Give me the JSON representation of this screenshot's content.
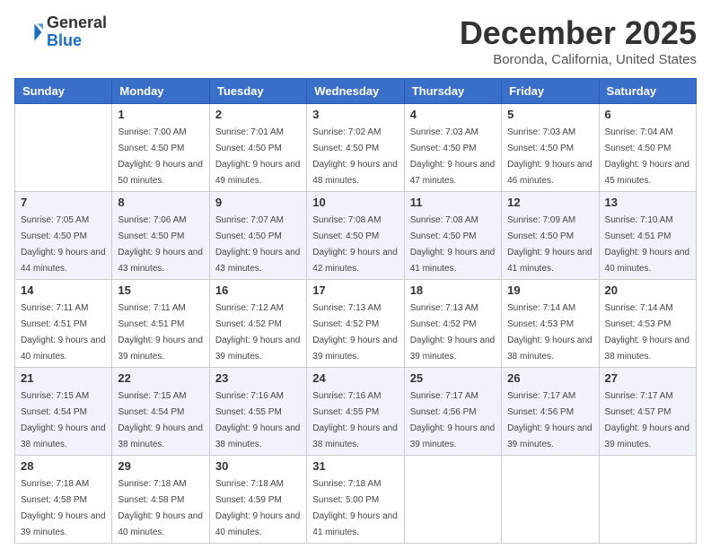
{
  "logo": {
    "general": "General",
    "blue": "Blue"
  },
  "header": {
    "month": "December 2025",
    "location": "Boronda, California, United States"
  },
  "weekdays": [
    "Sunday",
    "Monday",
    "Tuesday",
    "Wednesday",
    "Thursday",
    "Friday",
    "Saturday"
  ],
  "weeks": [
    [
      {
        "day": "",
        "sunrise": "",
        "sunset": "",
        "daylight": ""
      },
      {
        "day": "1",
        "sunrise": "Sunrise: 7:00 AM",
        "sunset": "Sunset: 4:50 PM",
        "daylight": "Daylight: 9 hours and 50 minutes."
      },
      {
        "day": "2",
        "sunrise": "Sunrise: 7:01 AM",
        "sunset": "Sunset: 4:50 PM",
        "daylight": "Daylight: 9 hours and 49 minutes."
      },
      {
        "day": "3",
        "sunrise": "Sunrise: 7:02 AM",
        "sunset": "Sunset: 4:50 PM",
        "daylight": "Daylight: 9 hours and 48 minutes."
      },
      {
        "day": "4",
        "sunrise": "Sunrise: 7:03 AM",
        "sunset": "Sunset: 4:50 PM",
        "daylight": "Daylight: 9 hours and 47 minutes."
      },
      {
        "day": "5",
        "sunrise": "Sunrise: 7:03 AM",
        "sunset": "Sunset: 4:50 PM",
        "daylight": "Daylight: 9 hours and 46 minutes."
      },
      {
        "day": "6",
        "sunrise": "Sunrise: 7:04 AM",
        "sunset": "Sunset: 4:50 PM",
        "daylight": "Daylight: 9 hours and 45 minutes."
      }
    ],
    [
      {
        "day": "7",
        "sunrise": "Sunrise: 7:05 AM",
        "sunset": "Sunset: 4:50 PM",
        "daylight": "Daylight: 9 hours and 44 minutes."
      },
      {
        "day": "8",
        "sunrise": "Sunrise: 7:06 AM",
        "sunset": "Sunset: 4:50 PM",
        "daylight": "Daylight: 9 hours and 43 minutes."
      },
      {
        "day": "9",
        "sunrise": "Sunrise: 7:07 AM",
        "sunset": "Sunset: 4:50 PM",
        "daylight": "Daylight: 9 hours and 43 minutes."
      },
      {
        "day": "10",
        "sunrise": "Sunrise: 7:08 AM",
        "sunset": "Sunset: 4:50 PM",
        "daylight": "Daylight: 9 hours and 42 minutes."
      },
      {
        "day": "11",
        "sunrise": "Sunrise: 7:08 AM",
        "sunset": "Sunset: 4:50 PM",
        "daylight": "Daylight: 9 hours and 41 minutes."
      },
      {
        "day": "12",
        "sunrise": "Sunrise: 7:09 AM",
        "sunset": "Sunset: 4:50 PM",
        "daylight": "Daylight: 9 hours and 41 minutes."
      },
      {
        "day": "13",
        "sunrise": "Sunrise: 7:10 AM",
        "sunset": "Sunset: 4:51 PM",
        "daylight": "Daylight: 9 hours and 40 minutes."
      }
    ],
    [
      {
        "day": "14",
        "sunrise": "Sunrise: 7:11 AM",
        "sunset": "Sunset: 4:51 PM",
        "daylight": "Daylight: 9 hours and 40 minutes."
      },
      {
        "day": "15",
        "sunrise": "Sunrise: 7:11 AM",
        "sunset": "Sunset: 4:51 PM",
        "daylight": "Daylight: 9 hours and 39 minutes."
      },
      {
        "day": "16",
        "sunrise": "Sunrise: 7:12 AM",
        "sunset": "Sunset: 4:52 PM",
        "daylight": "Daylight: 9 hours and 39 minutes."
      },
      {
        "day": "17",
        "sunrise": "Sunrise: 7:13 AM",
        "sunset": "Sunset: 4:52 PM",
        "daylight": "Daylight: 9 hours and 39 minutes."
      },
      {
        "day": "18",
        "sunrise": "Sunrise: 7:13 AM",
        "sunset": "Sunset: 4:52 PM",
        "daylight": "Daylight: 9 hours and 39 minutes."
      },
      {
        "day": "19",
        "sunrise": "Sunrise: 7:14 AM",
        "sunset": "Sunset: 4:53 PM",
        "daylight": "Daylight: 9 hours and 38 minutes."
      },
      {
        "day": "20",
        "sunrise": "Sunrise: 7:14 AM",
        "sunset": "Sunset: 4:53 PM",
        "daylight": "Daylight: 9 hours and 38 minutes."
      }
    ],
    [
      {
        "day": "21",
        "sunrise": "Sunrise: 7:15 AM",
        "sunset": "Sunset: 4:54 PM",
        "daylight": "Daylight: 9 hours and 38 minutes."
      },
      {
        "day": "22",
        "sunrise": "Sunrise: 7:15 AM",
        "sunset": "Sunset: 4:54 PM",
        "daylight": "Daylight: 9 hours and 38 minutes."
      },
      {
        "day": "23",
        "sunrise": "Sunrise: 7:16 AM",
        "sunset": "Sunset: 4:55 PM",
        "daylight": "Daylight: 9 hours and 38 minutes."
      },
      {
        "day": "24",
        "sunrise": "Sunrise: 7:16 AM",
        "sunset": "Sunset: 4:55 PM",
        "daylight": "Daylight: 9 hours and 38 minutes."
      },
      {
        "day": "25",
        "sunrise": "Sunrise: 7:17 AM",
        "sunset": "Sunset: 4:56 PM",
        "daylight": "Daylight: 9 hours and 39 minutes."
      },
      {
        "day": "26",
        "sunrise": "Sunrise: 7:17 AM",
        "sunset": "Sunset: 4:56 PM",
        "daylight": "Daylight: 9 hours and 39 minutes."
      },
      {
        "day": "27",
        "sunrise": "Sunrise: 7:17 AM",
        "sunset": "Sunset: 4:57 PM",
        "daylight": "Daylight: 9 hours and 39 minutes."
      }
    ],
    [
      {
        "day": "28",
        "sunrise": "Sunrise: 7:18 AM",
        "sunset": "Sunset: 4:58 PM",
        "daylight": "Daylight: 9 hours and 39 minutes."
      },
      {
        "day": "29",
        "sunrise": "Sunrise: 7:18 AM",
        "sunset": "Sunset: 4:58 PM",
        "daylight": "Daylight: 9 hours and 40 minutes."
      },
      {
        "day": "30",
        "sunrise": "Sunrise: 7:18 AM",
        "sunset": "Sunset: 4:59 PM",
        "daylight": "Daylight: 9 hours and 40 minutes."
      },
      {
        "day": "31",
        "sunrise": "Sunrise: 7:18 AM",
        "sunset": "Sunset: 5:00 PM",
        "daylight": "Daylight: 9 hours and 41 minutes."
      },
      {
        "day": "",
        "sunrise": "",
        "sunset": "",
        "daylight": ""
      },
      {
        "day": "",
        "sunrise": "",
        "sunset": "",
        "daylight": ""
      },
      {
        "day": "",
        "sunrise": "",
        "sunset": "",
        "daylight": ""
      }
    ]
  ]
}
